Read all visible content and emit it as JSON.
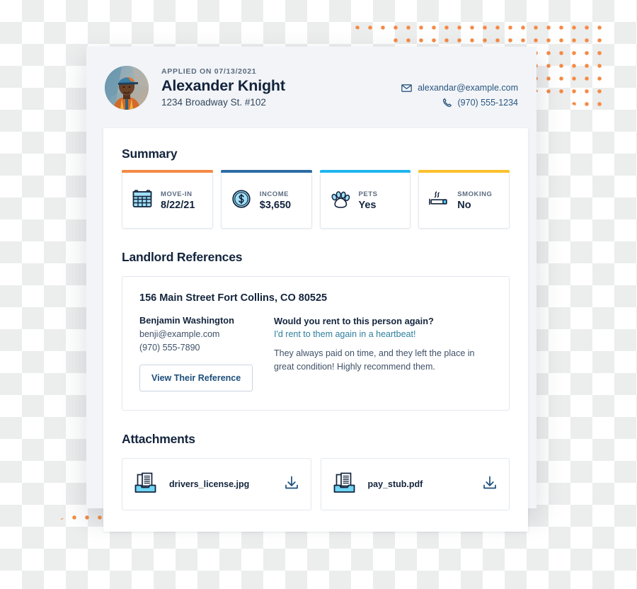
{
  "decor": {
    "dot_color": "#f58a44",
    "shell_bg": "#f2f4f7"
  },
  "header": {
    "applied_on": "APPLIED ON 07/13/2021",
    "name": "Alexander Knight",
    "address": "1234 Broadway St. #102",
    "email": "alexandar@example.com",
    "phone": "(970) 555-1234",
    "email_icon": "envelope-icon",
    "phone_icon": "phone-icon",
    "avatar_alt": "applicant-photo"
  },
  "summary": {
    "title": "Summary",
    "cards": [
      {
        "label": "MOVE-IN",
        "value": "8/22/21",
        "accent": "#f58a44",
        "icon": "calendar-icon"
      },
      {
        "label": "INCOME",
        "value": "$3,650",
        "accent": "#2c6ca3",
        "icon": "dollar-coin-icon"
      },
      {
        "label": "PETS",
        "value": "Yes",
        "accent": "#1fb6ef",
        "icon": "paw-icon"
      },
      {
        "label": "SMOKING",
        "value": "No",
        "accent": "#fbc02d",
        "icon": "cigarette-icon"
      }
    ]
  },
  "landlord_references": {
    "title": "Landlord References",
    "reference": {
      "address": "156 Main Street Fort Collins, CO 80525",
      "name": "Benjamin Washington",
      "email": "benji@example.com",
      "phone": "(970) 555-7890",
      "button_label": "View Their Reference",
      "question": "Would you rent to this person again?",
      "answer": "I'd rent to them again in a heartbeat!",
      "note": "They always paid on time, and they left the place in great condition! Highly recommend them."
    }
  },
  "attachments": {
    "title": "Attachments",
    "files": [
      {
        "name": "drivers_license.jpg",
        "icon": "documents-tray-icon",
        "action_icon": "download-icon"
      },
      {
        "name": "pay_stub.pdf",
        "icon": "documents-tray-icon",
        "action_icon": "download-icon"
      }
    ]
  }
}
